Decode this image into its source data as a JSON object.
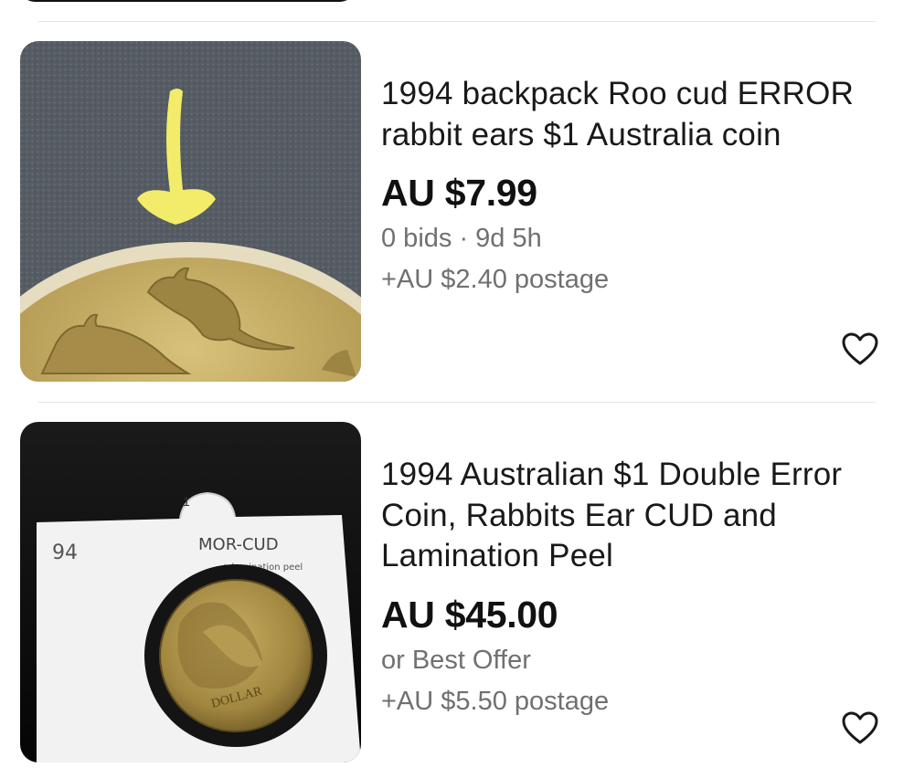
{
  "listings": [
    {
      "title": "1994 backpack Roo cud ERROR rabbit ears $1 Australia coin",
      "price": "AU $7.99",
      "status": "0 bids · 9d 5h",
      "postage": "+AU $2.40 postage",
      "image_icon": "coin-closeup-with-arrow"
    },
    {
      "title": "1994 Australian $1 Double Error Coin, Rabbits Ear CUD and Lamination Peel",
      "price": "AU $45.00",
      "status": "or Best Offer",
      "postage": "+AU $5.50 postage",
      "image_icon": "coin-in-holder",
      "holder_text": {
        "year": "94",
        "tab": "1",
        "note": "MOR-CUD",
        "note2": "+ lamination peel",
        "coin": "DOLLAR"
      }
    }
  ],
  "colors": {
    "text": "#191919",
    "muted": "#707070",
    "divider": "#e5e5e5",
    "heart": "#191919"
  },
  "icons": {
    "watch": "heart-outline-icon"
  }
}
